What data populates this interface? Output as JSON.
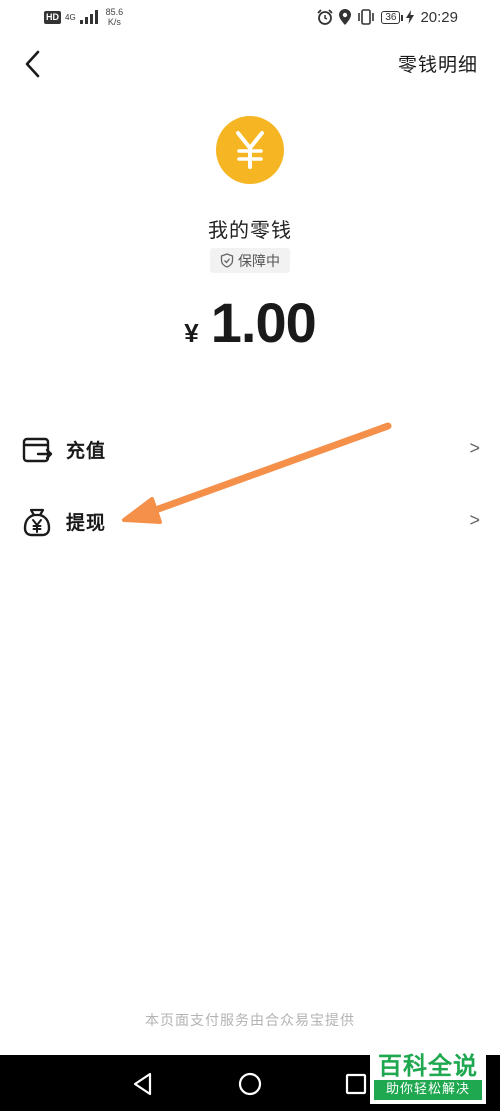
{
  "status_bar": {
    "hd": "HD",
    "network": "4G",
    "speed_value": "85.6",
    "speed_unit": "K/s",
    "battery": "36",
    "time": "20:29"
  },
  "header": {
    "detail_link": "零钱明细"
  },
  "wallet": {
    "title": "我的零钱",
    "protect_badge": "保障中",
    "currency_symbol": "¥",
    "balance": "1.00"
  },
  "menu": [
    {
      "label": "充值",
      "icon": "wallet-card-icon",
      "chevron": ">"
    },
    {
      "label": "提现",
      "icon": "money-bag-icon",
      "chevron": ">"
    }
  ],
  "footer": {
    "text": "本页面支付服务由合众易宝提供"
  },
  "watermark": {
    "main": "百科全说",
    "sub": "助你轻松解决"
  },
  "colors": {
    "coin": "#f6b623",
    "annotation_arrow": "#f5904a",
    "watermark_green": "#1fa84f"
  }
}
